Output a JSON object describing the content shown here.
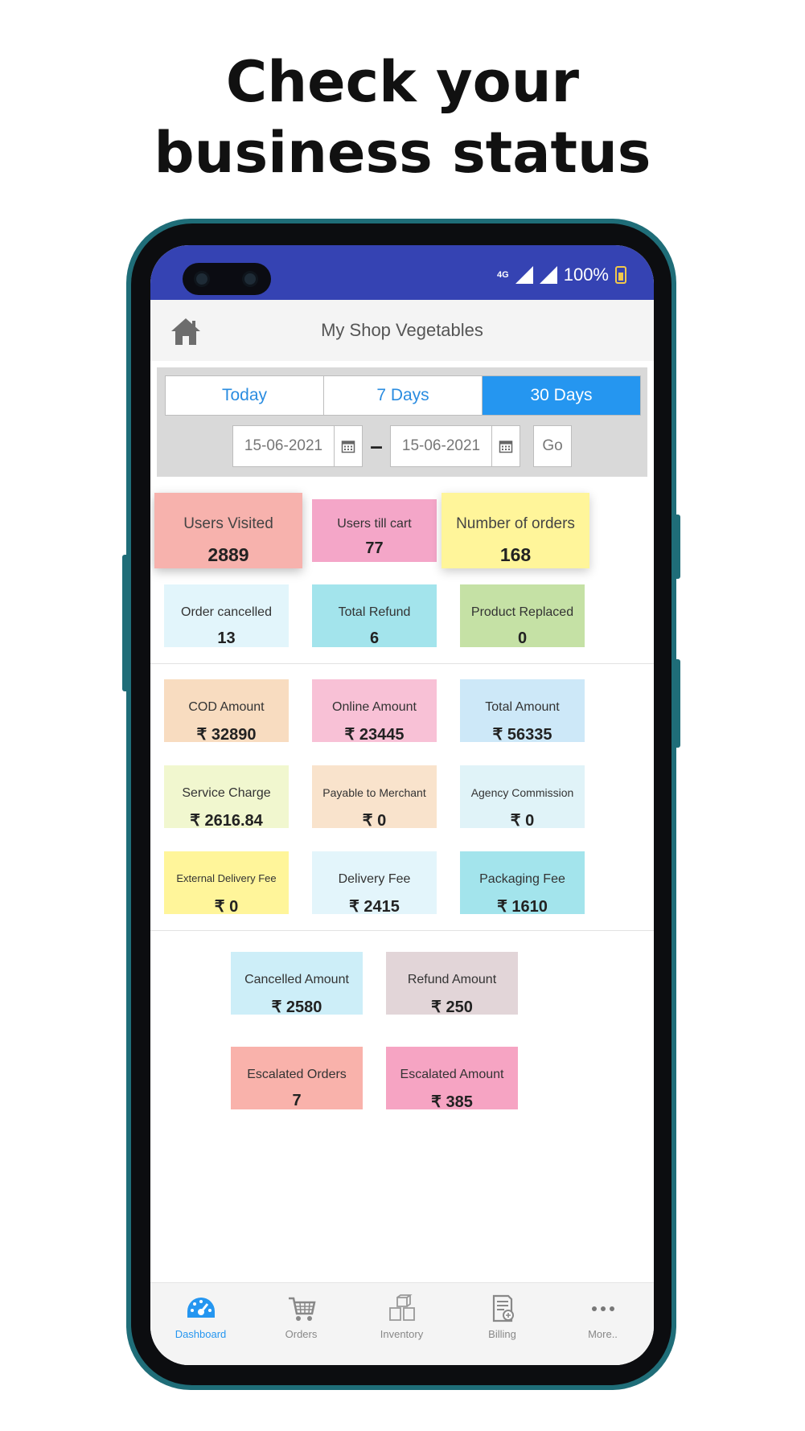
{
  "headline": {
    "line1": "Check your",
    "line2": "business status"
  },
  "status_bar": {
    "network": "4G",
    "battery": "100%"
  },
  "header": {
    "title": "My Shop Vegetables"
  },
  "filters": {
    "tabs": [
      {
        "label": "Today",
        "active": false
      },
      {
        "label": "7 Days",
        "active": false
      },
      {
        "label": "30 Days",
        "active": true
      }
    ],
    "from_date": "15-06-2021",
    "to_date": "15-06-2021",
    "separator": "–",
    "go_label": "Go"
  },
  "stats": {
    "users_visited": {
      "label": "Users Visited",
      "value": "2889"
    },
    "users_till_cart": {
      "label": "Users till cart",
      "value": "77"
    },
    "number_of_orders": {
      "label": "Number of orders",
      "value": "168"
    },
    "order_cancelled": {
      "label": "Order cancelled",
      "value": "13"
    },
    "total_refund": {
      "label": "Total Refund",
      "value": "6"
    },
    "product_replaced": {
      "label": "Product Replaced",
      "value": "0"
    },
    "cod_amount": {
      "label": "COD Amount",
      "value": "₹ 32890"
    },
    "online_amount": {
      "label": "Online Amount",
      "value": "₹ 23445"
    },
    "total_amount": {
      "label": "Total Amount",
      "value": "₹ 56335"
    },
    "service_charge": {
      "label": "Service Charge",
      "value": "₹ 2616.84"
    },
    "payable_to_merchant": {
      "label": "Payable to Merchant",
      "value": "₹ 0"
    },
    "agency_commission": {
      "label": "Agency Commission",
      "value": "₹ 0"
    },
    "external_delivery_fee": {
      "label": "External Delivery Fee",
      "value": "₹ 0"
    },
    "delivery_fee": {
      "label": "Delivery Fee",
      "value": "₹ 2415"
    },
    "packaging_fee": {
      "label": "Packaging Fee",
      "value": "₹ 1610"
    },
    "cancelled_amount": {
      "label": "Cancelled Amount",
      "value": "₹ 2580"
    },
    "refund_amount": {
      "label": "Refund Amount",
      "value": "₹ 250"
    },
    "escalated_orders": {
      "label": "Escalated Orders",
      "value": "7"
    },
    "escalated_amount": {
      "label": "Escalated Amount",
      "value": "₹ 385"
    }
  },
  "colors": {
    "status_bar": "#3543b3",
    "accent": "#2596f0",
    "phone_frame": "#1f6d78"
  },
  "bottom_nav": [
    {
      "label": "Dashboard",
      "icon": "dashboard-icon",
      "active": true
    },
    {
      "label": "Orders",
      "icon": "cart-icon",
      "active": false
    },
    {
      "label": "Inventory",
      "icon": "boxes-icon",
      "active": false
    },
    {
      "label": "Billing",
      "icon": "billing-icon",
      "active": false
    },
    {
      "label": "More..",
      "icon": "more-icon",
      "active": false
    }
  ]
}
